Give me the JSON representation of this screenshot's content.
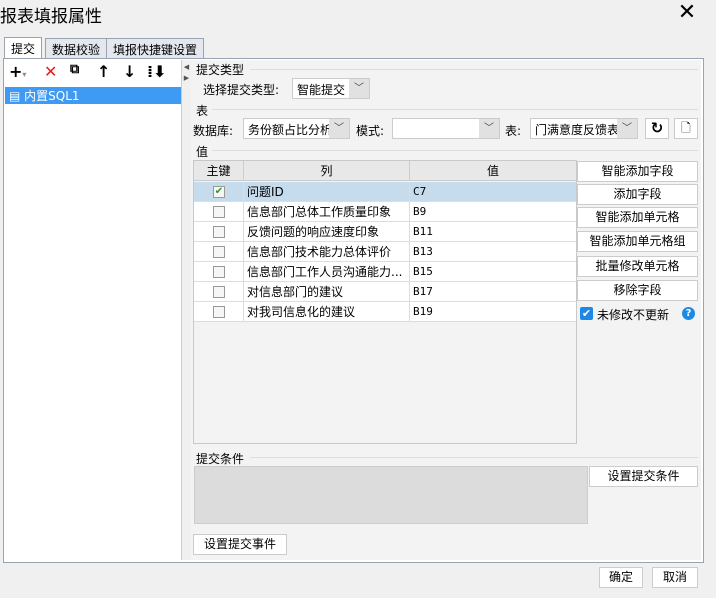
{
  "window": {
    "title": "报表填报属性"
  },
  "tabs": [
    "提交",
    "数据校验",
    "填报快捷键设置"
  ],
  "tree": {
    "item": "内置SQL1"
  },
  "submit_type": {
    "section": "提交类型",
    "label": "选择提交类型:",
    "value": "智能提交"
  },
  "table_section": {
    "section": "表",
    "db_label": "数据库:",
    "db_value": "务份额占比分析",
    "mode_label": "模式:",
    "mode_value": "",
    "table_label": "表:",
    "table_value": "门满意度反馈表"
  },
  "values": {
    "section": "值",
    "headers": [
      "主键",
      "列",
      "值"
    ],
    "rows": [
      {
        "key": true,
        "col": "问题ID",
        "val": "C7"
      },
      {
        "key": false,
        "col": "信息部门总体工作质量印象",
        "val": "B9"
      },
      {
        "key": false,
        "col": "反馈问题的响应速度印象",
        "val": "B11"
      },
      {
        "key": false,
        "col": "信息部门技术能力总体评价",
        "val": "B13"
      },
      {
        "key": false,
        "col": "信息部门工作人员沟通能力...",
        "val": "B15"
      },
      {
        "key": false,
        "col": "对信息部门的建议",
        "val": "B17"
      },
      {
        "key": false,
        "col": "对我司信息化的建议",
        "val": "B19"
      }
    ]
  },
  "side_buttons": [
    "智能添加字段",
    "添加字段",
    "智能添加单元格",
    "智能添加单元格组",
    "批量修改单元格",
    "移除字段"
  ],
  "no_update": {
    "label": "未修改不更新",
    "checked": true
  },
  "condition": {
    "section": "提交条件",
    "button": "设置提交条件"
  },
  "event_button": "设置提交事件",
  "footer": {
    "ok": "确定",
    "cancel": "取消"
  }
}
